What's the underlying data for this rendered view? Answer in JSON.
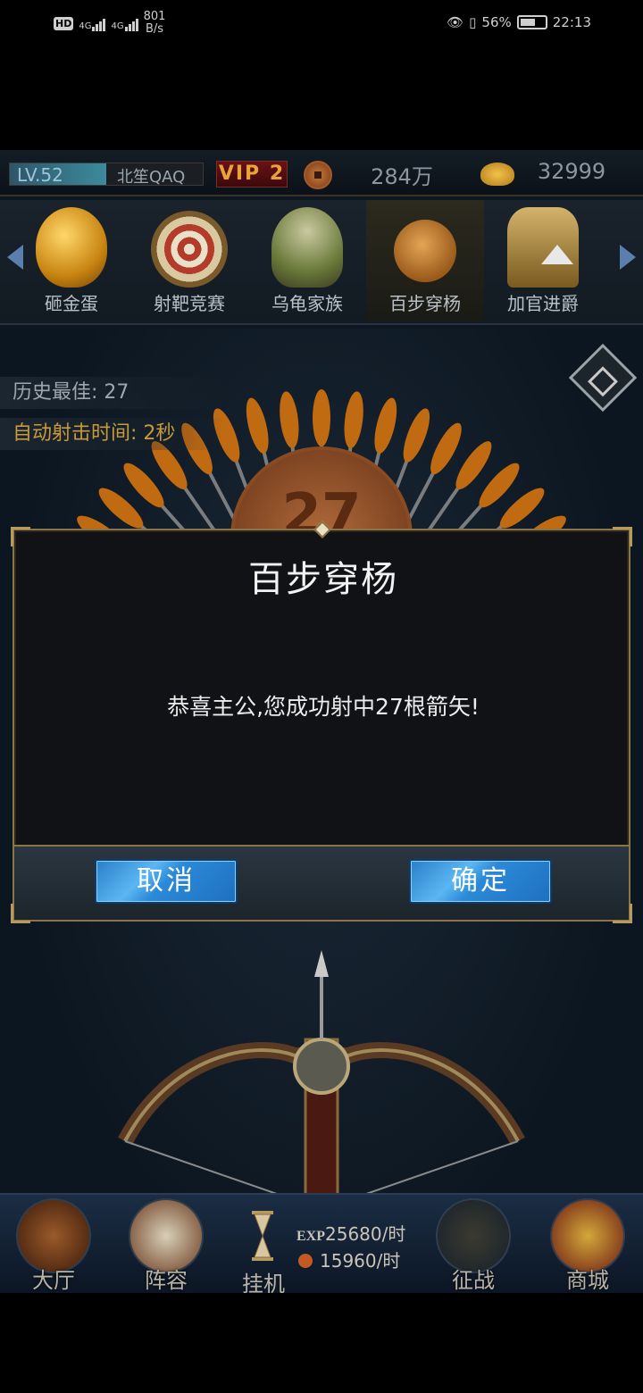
{
  "status_bar": {
    "hd": "HD",
    "net1": "4G",
    "net2": "4G",
    "speed_value": "801",
    "speed_unit": "B/s",
    "battery_percent": "56%",
    "time": "22:13"
  },
  "player": {
    "level": "LV.52",
    "name": "北笙QAQ",
    "level_progress": 0.5,
    "vip": "VIP 2",
    "copper": "284万",
    "gold": "32999"
  },
  "events": [
    {
      "label": "砸金蛋",
      "icon": "golden-egg"
    },
    {
      "label": "射靶竞赛",
      "icon": "target"
    },
    {
      "label": "乌龟家族",
      "icon": "turtle"
    },
    {
      "label": "百步穿杨",
      "icon": "arrow-ball",
      "active": true
    },
    {
      "label": "加官进爵",
      "icon": "lion-seal"
    }
  ],
  "stats": {
    "best": "历史最佳: 27",
    "auto_time": "自动射击时间: 2秒"
  },
  "score_display": "27",
  "dialog": {
    "title": "百步穿杨",
    "message": "恭喜主公,您成功射中27根箭矢!",
    "cancel": "取消",
    "confirm": "确定"
  },
  "bottom_nav": {
    "hall": "大厅",
    "lineup": "阵容",
    "idle": "挂机",
    "exp_tag": "EXP",
    "exp_rate": "25680/时",
    "gold_rate": "15960/时",
    "battle": "征战",
    "shop": "商城"
  },
  "colors": {
    "accent_gold": "#8b7448",
    "button_blue": "#2b8ad8",
    "vip_red": "#6a1216",
    "vip_text": "#e8a43a",
    "auto_text": "#c89a3a"
  }
}
